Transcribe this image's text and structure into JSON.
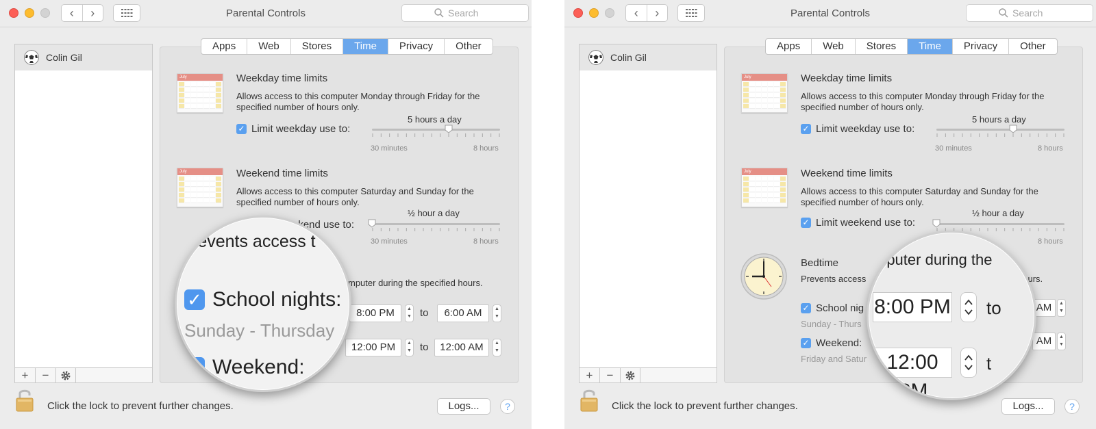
{
  "window": {
    "title": "Parental Controls"
  },
  "search": {
    "placeholder": "Search"
  },
  "user": {
    "name": "Colin Gil"
  },
  "tabs": [
    "Apps",
    "Web",
    "Stores",
    "Time",
    "Privacy",
    "Other"
  ],
  "active_tab": "Time",
  "weekday": {
    "title": "Weekday time limits",
    "desc": "Allows access to this computer Monday through Friday for the specified number of hours only.",
    "checkbox_label": "Limit weekday use to:",
    "value_label": "5 hours a day",
    "slider_min": "30 minutes",
    "slider_max": "8 hours",
    "slider_fraction": 0.6
  },
  "weekend": {
    "title": "Weekend time limits",
    "desc": "Allows access to this computer Saturday and Sunday for the specified number of hours only.",
    "checkbox_label": "Limit weekend use to:",
    "value_label": "½ hour a day",
    "slider_min": "30 minutes",
    "slider_max": "8 hours",
    "slider_fraction": 0.0
  },
  "bedtime": {
    "title": "Bedtime",
    "desc": "Prevents access to this computer during the specified hours.",
    "school_nights_label": "School nights:",
    "school_nights_sub": "Sunday - Thursday",
    "school_from": "8:00 PM",
    "school_to": "6:00 AM",
    "weekend_label": "Weekend:",
    "weekend_sub": "Friday and Saturday",
    "weekend_from": "12:00 PM",
    "weekend_to": "12:00 AM",
    "to_label": "to"
  },
  "calendar_month": "July",
  "left_peek": {
    "weekend_desc_tail": "ekend use to:",
    "bedtime_desc_tail": "mputer during the specified hours."
  },
  "right_peek": {
    "school_label_clipped": "School nig",
    "school_sub_clipped": "Sunday - Thurs",
    "weekend_sub_clipped": "Friday and Satur",
    "prevents_clipped": "Prevents access",
    "hours_tail": "hours.",
    "school_to_clipped": "AM",
    "weekend_to_clipped": "AM"
  },
  "left_zoom": {
    "desc_fragment": "revents access t",
    "school_nights_label": "School nights:",
    "school_nights_sub": "Sunday - Thursday",
    "weekend_label": "Weekend:"
  },
  "right_zoom": {
    "desc_fragment": "mputer during the",
    "from_time": "8:00 PM",
    "second_time": "12:00 PM",
    "to_label": "to",
    "to_clipped": "t"
  },
  "footer": {
    "lock_text": "Click the lock to prevent further changes.",
    "logs_label": "Logs...",
    "help_label": "?"
  },
  "sidebar_toolbar": {
    "add": "+",
    "remove": "−"
  },
  "colors": {
    "accent": "#6ba7ec",
    "checkbox": "#5aa0ef"
  }
}
